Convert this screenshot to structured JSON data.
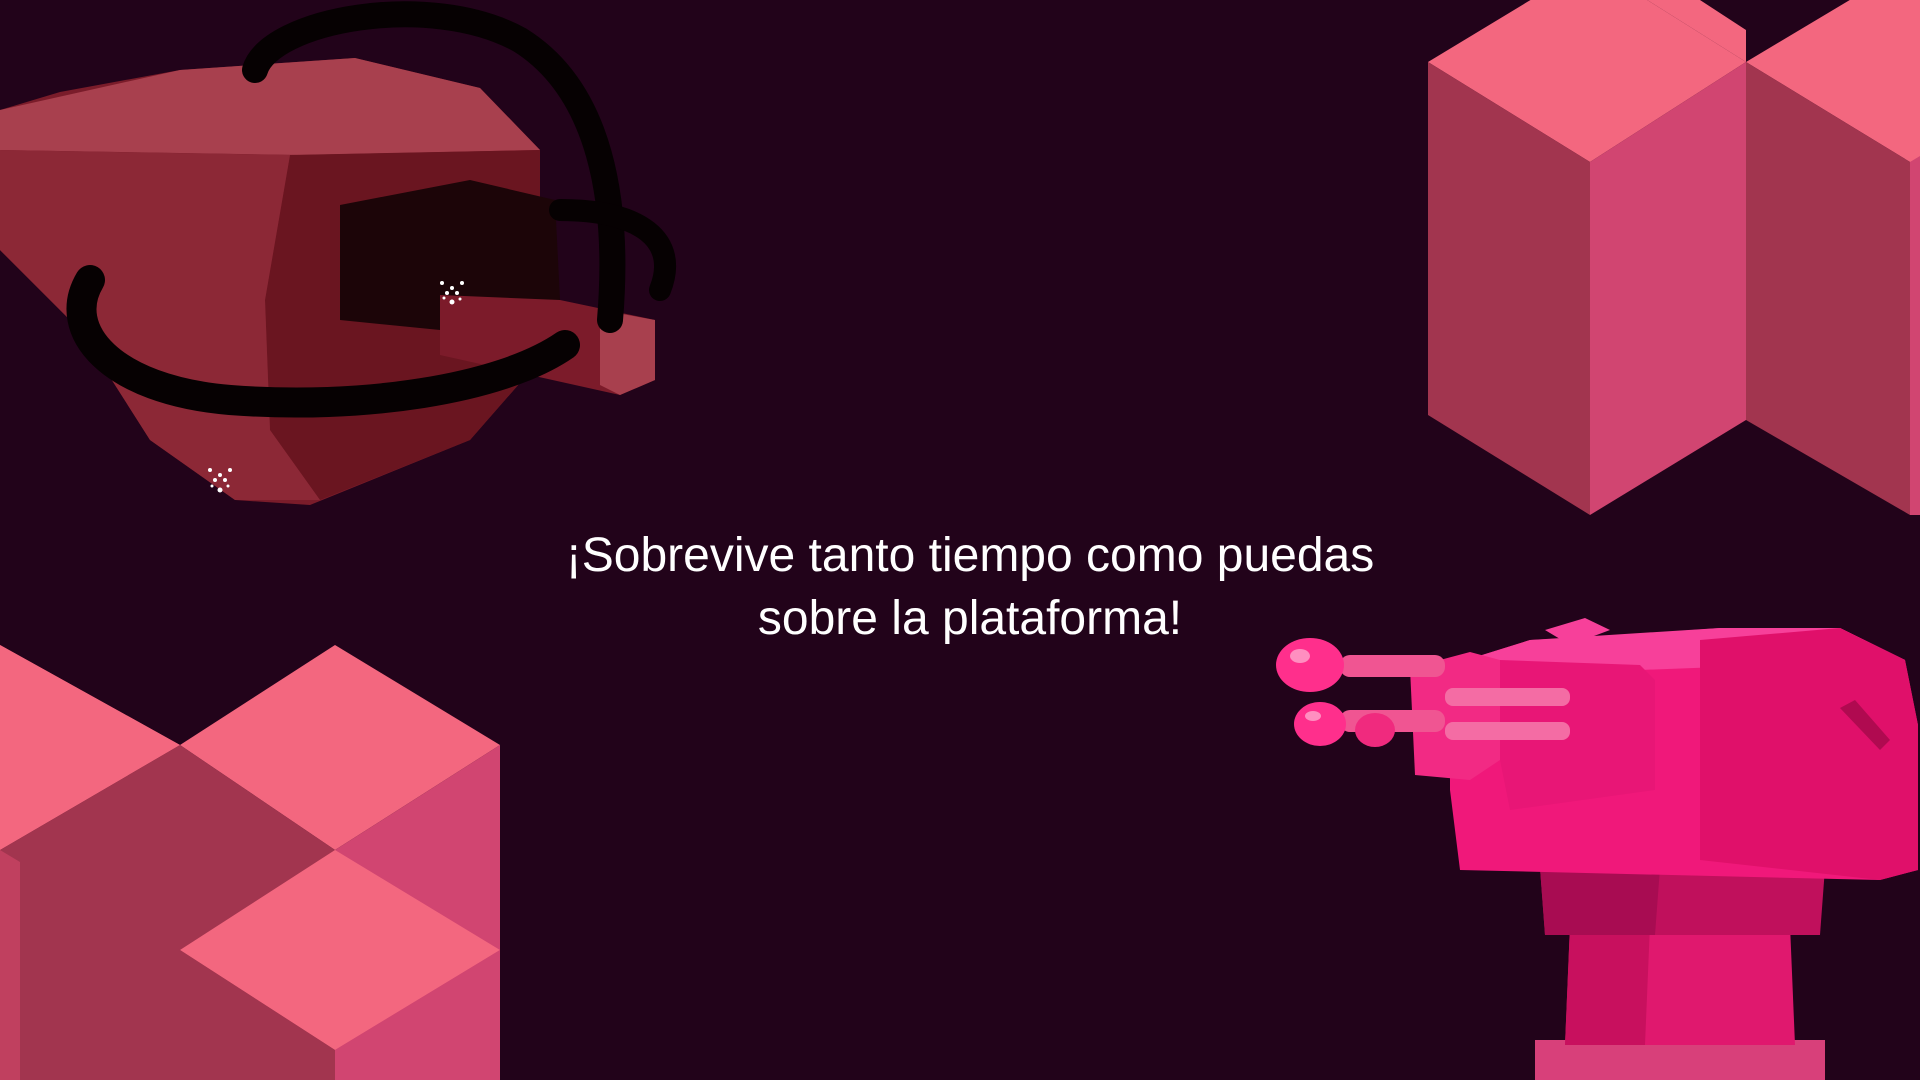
{
  "screen": {
    "name": "tutorial-hint",
    "message_line_1": "¡Sobrevive tanto tiempo como puedas",
    "message_line_2": "sobre la plataforma!"
  },
  "scene": {
    "background": "#22031a",
    "objects": [
      {
        "name": "projector-cannon",
        "color": "#a8404e"
      },
      {
        "name": "cube-stack-top-right",
        "color": "#e0507a"
      },
      {
        "name": "cube-stack-bottom-left",
        "color": "#e0507a"
      },
      {
        "name": "turret",
        "color": "#f0187a"
      }
    ]
  },
  "colors": {
    "text": "#ffffff",
    "cube_top": "#f3677f",
    "cube_left": "#a2354f",
    "cube_right": "#d14571",
    "turret_body": "#f0187a"
  }
}
